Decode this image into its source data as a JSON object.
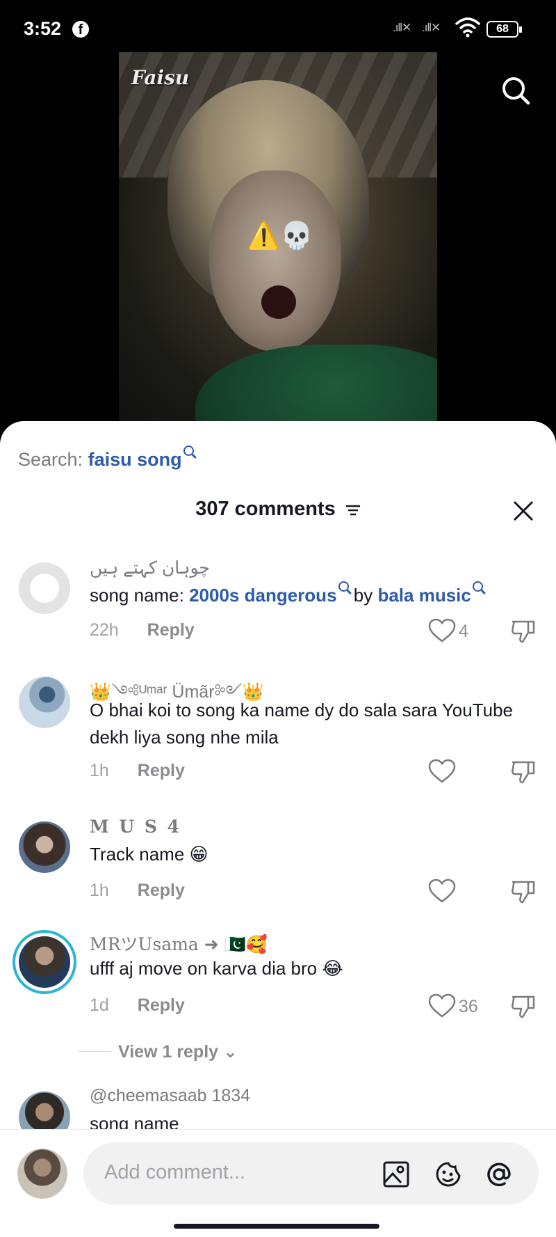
{
  "status_bar": {
    "time": "3:52",
    "battery": "68",
    "signal_1": ".ıll✕",
    "signal_2": ".ıll✕"
  },
  "video": {
    "watermark": "Faisu",
    "overlay_emojis": "⚠️💀"
  },
  "sheet": {
    "search_prefix": "Search:",
    "search_query": "faisu song",
    "comments_title": "307 comments"
  },
  "comments": [
    {
      "username": "چوہان کہتے ہیں",
      "text_prefix": "song name: ",
      "link1": "2000s dangerous",
      "text_mid": " by ",
      "link2": "bala music",
      "time": "22h",
      "reply": "Reply",
      "likes": "4"
    },
    {
      "username": "👑༺ᵁᵐᵃʳ Ümãr༻👑",
      "text": "O bhai koi to song ka name dy do sala sara YouTube dekh liya song nhe mila",
      "time": "1h",
      "reply": "Reply",
      "likes": ""
    },
    {
      "username": "M U S 4",
      "text": "Track name 😁",
      "time": "1h",
      "reply": "Reply",
      "likes": ""
    },
    {
      "username": "MRツUsama ➜ 🇵🇰🥰",
      "text": "ufff aj move on karva dia bro 😂",
      "time": "1d",
      "reply": "Reply",
      "likes": "36",
      "view_replies": "View 1 reply"
    },
    {
      "username": "@cheemasaab 1834",
      "text": "song name"
    }
  ],
  "composer": {
    "placeholder": "Add comment..."
  },
  "icons": [
    "search-icon",
    "close-icon",
    "filter-icon",
    "heart-icon",
    "dislike-icon",
    "image-icon",
    "emoji-icon",
    "mention-icon"
  ]
}
